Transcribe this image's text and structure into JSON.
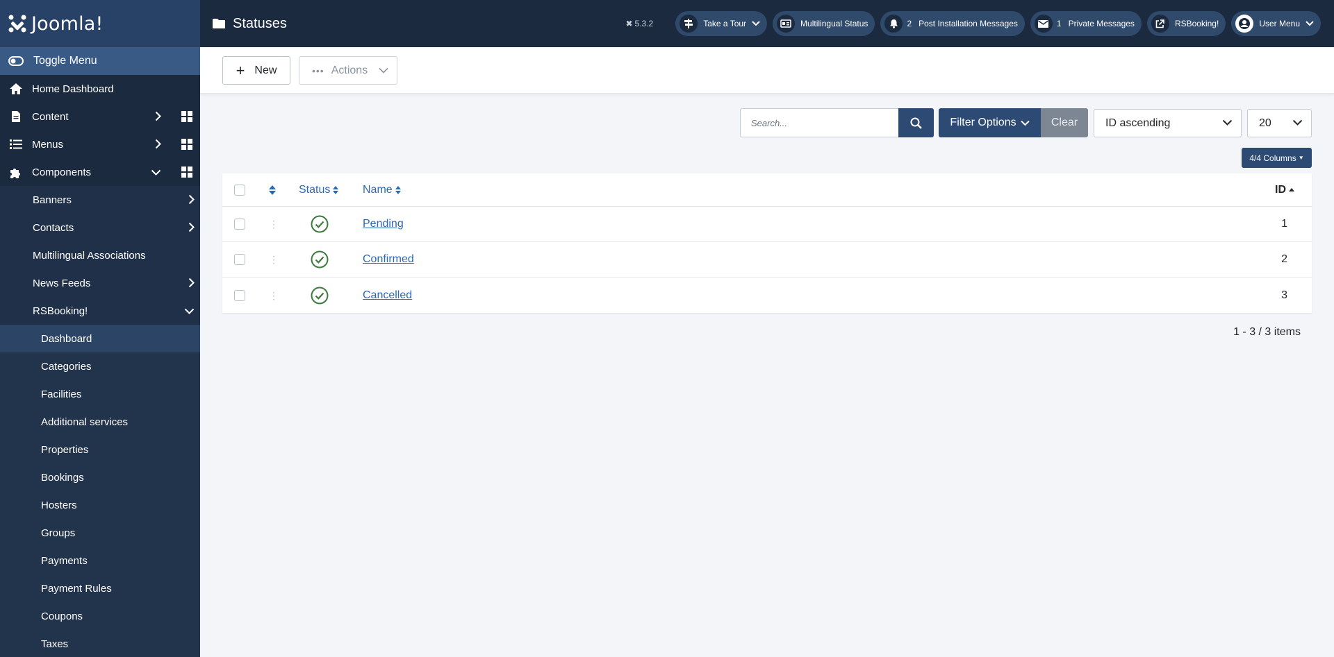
{
  "brand": {
    "name": "Joomla!"
  },
  "header": {
    "title": "Statuses",
    "version": "5.3.2",
    "pills": [
      {
        "label": "Take a Tour",
        "icon": "signpost-icon"
      },
      {
        "label": "Multilingual Status",
        "icon": "language-card-icon"
      },
      {
        "label": "Post Installation Messages",
        "count": "2",
        "icon": "bell-icon"
      },
      {
        "label": "Private Messages",
        "count": "1",
        "icon": "envelope-icon"
      },
      {
        "label": "RSBooking!",
        "icon": "external-link-icon"
      },
      {
        "label": "User Menu",
        "icon": "user-circle-icon"
      }
    ]
  },
  "sidebar": {
    "toggle_label": "Toggle Menu",
    "items": [
      {
        "label": "Home Dashboard"
      },
      {
        "label": "Content"
      },
      {
        "label": "Menus"
      },
      {
        "label": "Components"
      }
    ],
    "components": [
      {
        "label": "Banners"
      },
      {
        "label": "Contacts"
      },
      {
        "label": "Multilingual Associations"
      },
      {
        "label": "News Feeds"
      },
      {
        "label": "RSBooking!"
      }
    ],
    "rsbooking": [
      {
        "label": "Dashboard"
      },
      {
        "label": "Categories"
      },
      {
        "label": "Facilities"
      },
      {
        "label": "Additional services"
      },
      {
        "label": "Properties"
      },
      {
        "label": "Bookings"
      },
      {
        "label": "Hosters"
      },
      {
        "label": "Groups"
      },
      {
        "label": "Payments"
      },
      {
        "label": "Payment Rules"
      },
      {
        "label": "Coupons"
      },
      {
        "label": "Taxes"
      }
    ]
  },
  "toolbar": {
    "new_label": "New",
    "actions_label": "Actions"
  },
  "filters": {
    "search_placeholder": "Search...",
    "filter_options_label": "Filter Options",
    "clear_label": "Clear",
    "ordering_value": "ID ascending",
    "limit_value": "20",
    "columns_label": "4/4 Columns"
  },
  "table": {
    "headers": {
      "status": "Status",
      "name": "Name",
      "id": "ID"
    },
    "rows": [
      {
        "name": "Pending",
        "id": "1"
      },
      {
        "name": "Confirmed",
        "id": "2"
      },
      {
        "name": "Cancelled",
        "id": "3"
      }
    ]
  },
  "pagination": {
    "info": "1 - 3 / 3 items"
  },
  "colors": {
    "header_bg": "#1b2a3e",
    "accent": "#2c4a73",
    "link": "#2a69b8",
    "published": "#3d7a3d"
  }
}
